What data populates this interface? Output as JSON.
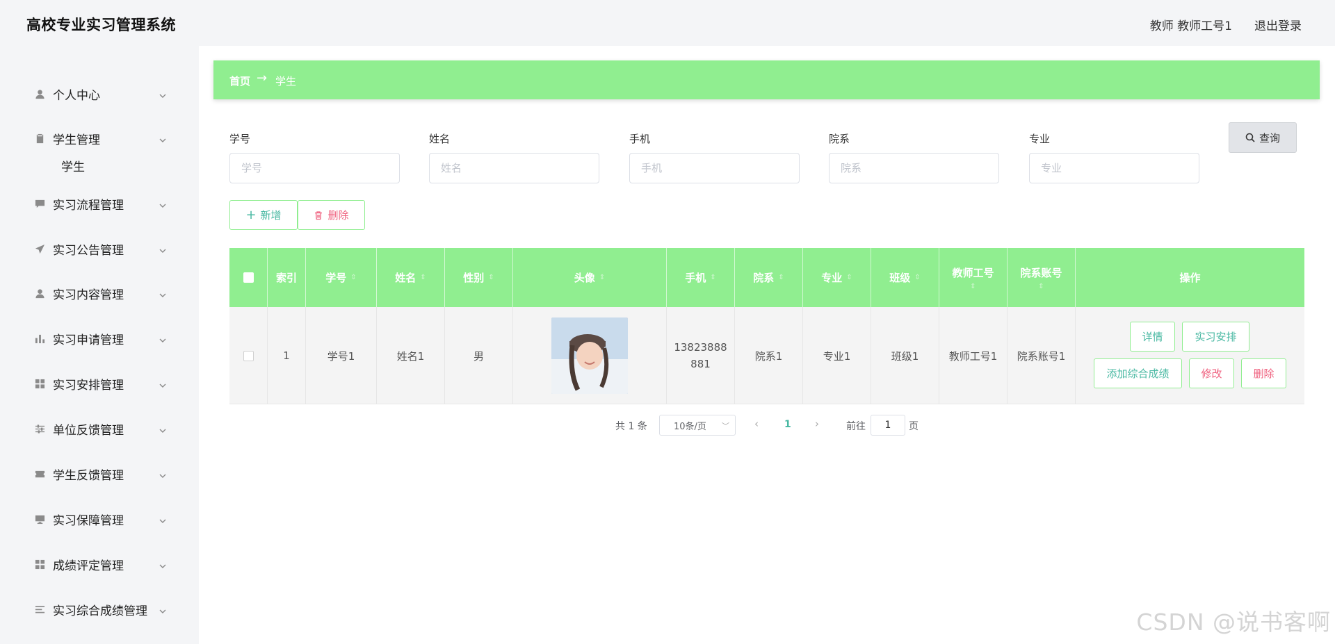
{
  "header": {
    "app_title": "高校专业实习管理系统",
    "user_info": "教师 教师工号1",
    "logout_label": "退出登录"
  },
  "sidebar": {
    "items": [
      {
        "label": "个人中心",
        "icon": "user-icon"
      },
      {
        "label": "学生管理",
        "icon": "clipboard-icon"
      },
      {
        "label": "实习流程管理",
        "icon": "chat-icon"
      },
      {
        "label": "实习公告管理",
        "icon": "send-icon"
      },
      {
        "label": "实习内容管理",
        "icon": "user-icon"
      },
      {
        "label": "实习申请管理",
        "icon": "bar-chart-icon"
      },
      {
        "label": "实习安排管理",
        "icon": "grid-icon"
      },
      {
        "label": "单位反馈管理",
        "icon": "sliders-icon"
      },
      {
        "label": "学生反馈管理",
        "icon": "ticket-icon"
      },
      {
        "label": "实习保障管理",
        "icon": "monitor-icon"
      },
      {
        "label": "成绩评定管理",
        "icon": "grid-icon"
      },
      {
        "label": "实习综合成绩管理",
        "icon": "list-icon"
      }
    ],
    "submenu": {
      "label": "学生"
    }
  },
  "breadcrumb": {
    "home": "首页",
    "arrow": "→",
    "current": "学生"
  },
  "filters": [
    {
      "label": "学号",
      "placeholder": "学号"
    },
    {
      "label": "姓名",
      "placeholder": "姓名"
    },
    {
      "label": "手机",
      "placeholder": "手机"
    },
    {
      "label": "院系",
      "placeholder": "院系"
    },
    {
      "label": "专业",
      "placeholder": "专业"
    }
  ],
  "toolbar": {
    "query_label": "查询",
    "add_label": "新增",
    "delete_label": "删除"
  },
  "table": {
    "headers": {
      "index": "索引",
      "student_id": "学号",
      "name": "姓名",
      "gender": "性别",
      "avatar": "头像",
      "phone": "手机",
      "department": "院系",
      "major": "专业",
      "class": "班级",
      "teacher_id": "教师工号",
      "dept_account": "院系账号",
      "actions": "操作"
    },
    "rows": [
      {
        "index": "1",
        "student_id": "学号1",
        "name": "姓名1",
        "gender": "男",
        "phone_line1": "13823888",
        "phone_line2": "881",
        "department": "院系1",
        "major": "专业1",
        "class": "班级1",
        "teacher_id": "教师工号1",
        "dept_account": "院系账号1",
        "actions": {
          "detail": "详情",
          "arrange": "实习安排",
          "add_score": "添加综合成绩",
          "edit": "修改",
          "delete": "删除"
        }
      }
    ]
  },
  "pagination": {
    "total": "共 1 条",
    "page_size": "10条/页",
    "current_page": "1",
    "goto_prefix": "前往",
    "goto_value": "1",
    "goto_suffix": "页"
  },
  "watermark": "CSDN @说书客啊",
  "colors": {
    "accent_green": "#90ee90",
    "teal_text": "#48b8a2",
    "danger_text": "#ef5f7d"
  }
}
